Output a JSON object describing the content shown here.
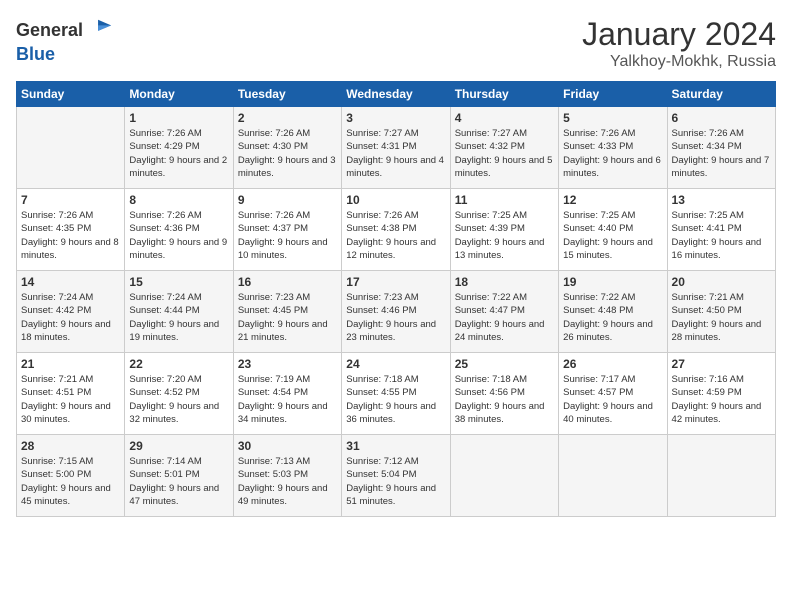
{
  "header": {
    "logo_line1": "General",
    "logo_line2": "Blue",
    "month": "January 2024",
    "location": "Yalkhoy-Mokhk, Russia"
  },
  "days_of_week": [
    "Sunday",
    "Monday",
    "Tuesday",
    "Wednesday",
    "Thursday",
    "Friday",
    "Saturday"
  ],
  "weeks": [
    [
      {
        "day": "",
        "sunrise": "",
        "sunset": "",
        "daylight": ""
      },
      {
        "day": "1",
        "sunrise": "Sunrise: 7:26 AM",
        "sunset": "Sunset: 4:29 PM",
        "daylight": "Daylight: 9 hours and 2 minutes."
      },
      {
        "day": "2",
        "sunrise": "Sunrise: 7:26 AM",
        "sunset": "Sunset: 4:30 PM",
        "daylight": "Daylight: 9 hours and 3 minutes."
      },
      {
        "day": "3",
        "sunrise": "Sunrise: 7:27 AM",
        "sunset": "Sunset: 4:31 PM",
        "daylight": "Daylight: 9 hours and 4 minutes."
      },
      {
        "day": "4",
        "sunrise": "Sunrise: 7:27 AM",
        "sunset": "Sunset: 4:32 PM",
        "daylight": "Daylight: 9 hours and 5 minutes."
      },
      {
        "day": "5",
        "sunrise": "Sunrise: 7:26 AM",
        "sunset": "Sunset: 4:33 PM",
        "daylight": "Daylight: 9 hours and 6 minutes."
      },
      {
        "day": "6",
        "sunrise": "Sunrise: 7:26 AM",
        "sunset": "Sunset: 4:34 PM",
        "daylight": "Daylight: 9 hours and 7 minutes."
      }
    ],
    [
      {
        "day": "7",
        "sunrise": "Sunrise: 7:26 AM",
        "sunset": "Sunset: 4:35 PM",
        "daylight": "Daylight: 9 hours and 8 minutes."
      },
      {
        "day": "8",
        "sunrise": "Sunrise: 7:26 AM",
        "sunset": "Sunset: 4:36 PM",
        "daylight": "Daylight: 9 hours and 9 minutes."
      },
      {
        "day": "9",
        "sunrise": "Sunrise: 7:26 AM",
        "sunset": "Sunset: 4:37 PM",
        "daylight": "Daylight: 9 hours and 10 minutes."
      },
      {
        "day": "10",
        "sunrise": "Sunrise: 7:26 AM",
        "sunset": "Sunset: 4:38 PM",
        "daylight": "Daylight: 9 hours and 12 minutes."
      },
      {
        "day": "11",
        "sunrise": "Sunrise: 7:25 AM",
        "sunset": "Sunset: 4:39 PM",
        "daylight": "Daylight: 9 hours and 13 minutes."
      },
      {
        "day": "12",
        "sunrise": "Sunrise: 7:25 AM",
        "sunset": "Sunset: 4:40 PM",
        "daylight": "Daylight: 9 hours and 15 minutes."
      },
      {
        "day": "13",
        "sunrise": "Sunrise: 7:25 AM",
        "sunset": "Sunset: 4:41 PM",
        "daylight": "Daylight: 9 hours and 16 minutes."
      }
    ],
    [
      {
        "day": "14",
        "sunrise": "Sunrise: 7:24 AM",
        "sunset": "Sunset: 4:42 PM",
        "daylight": "Daylight: 9 hours and 18 minutes."
      },
      {
        "day": "15",
        "sunrise": "Sunrise: 7:24 AM",
        "sunset": "Sunset: 4:44 PM",
        "daylight": "Daylight: 9 hours and 19 minutes."
      },
      {
        "day": "16",
        "sunrise": "Sunrise: 7:23 AM",
        "sunset": "Sunset: 4:45 PM",
        "daylight": "Daylight: 9 hours and 21 minutes."
      },
      {
        "day": "17",
        "sunrise": "Sunrise: 7:23 AM",
        "sunset": "Sunset: 4:46 PM",
        "daylight": "Daylight: 9 hours and 23 minutes."
      },
      {
        "day": "18",
        "sunrise": "Sunrise: 7:22 AM",
        "sunset": "Sunset: 4:47 PM",
        "daylight": "Daylight: 9 hours and 24 minutes."
      },
      {
        "day": "19",
        "sunrise": "Sunrise: 7:22 AM",
        "sunset": "Sunset: 4:48 PM",
        "daylight": "Daylight: 9 hours and 26 minutes."
      },
      {
        "day": "20",
        "sunrise": "Sunrise: 7:21 AM",
        "sunset": "Sunset: 4:50 PM",
        "daylight": "Daylight: 9 hours and 28 minutes."
      }
    ],
    [
      {
        "day": "21",
        "sunrise": "Sunrise: 7:21 AM",
        "sunset": "Sunset: 4:51 PM",
        "daylight": "Daylight: 9 hours and 30 minutes."
      },
      {
        "day": "22",
        "sunrise": "Sunrise: 7:20 AM",
        "sunset": "Sunset: 4:52 PM",
        "daylight": "Daylight: 9 hours and 32 minutes."
      },
      {
        "day": "23",
        "sunrise": "Sunrise: 7:19 AM",
        "sunset": "Sunset: 4:54 PM",
        "daylight": "Daylight: 9 hours and 34 minutes."
      },
      {
        "day": "24",
        "sunrise": "Sunrise: 7:18 AM",
        "sunset": "Sunset: 4:55 PM",
        "daylight": "Daylight: 9 hours and 36 minutes."
      },
      {
        "day": "25",
        "sunrise": "Sunrise: 7:18 AM",
        "sunset": "Sunset: 4:56 PM",
        "daylight": "Daylight: 9 hours and 38 minutes."
      },
      {
        "day": "26",
        "sunrise": "Sunrise: 7:17 AM",
        "sunset": "Sunset: 4:57 PM",
        "daylight": "Daylight: 9 hours and 40 minutes."
      },
      {
        "day": "27",
        "sunrise": "Sunrise: 7:16 AM",
        "sunset": "Sunset: 4:59 PM",
        "daylight": "Daylight: 9 hours and 42 minutes."
      }
    ],
    [
      {
        "day": "28",
        "sunrise": "Sunrise: 7:15 AM",
        "sunset": "Sunset: 5:00 PM",
        "daylight": "Daylight: 9 hours and 45 minutes."
      },
      {
        "day": "29",
        "sunrise": "Sunrise: 7:14 AM",
        "sunset": "Sunset: 5:01 PM",
        "daylight": "Daylight: 9 hours and 47 minutes."
      },
      {
        "day": "30",
        "sunrise": "Sunrise: 7:13 AM",
        "sunset": "Sunset: 5:03 PM",
        "daylight": "Daylight: 9 hours and 49 minutes."
      },
      {
        "day": "31",
        "sunrise": "Sunrise: 7:12 AM",
        "sunset": "Sunset: 5:04 PM",
        "daylight": "Daylight: 9 hours and 51 minutes."
      },
      {
        "day": "",
        "sunrise": "",
        "sunset": "",
        "daylight": ""
      },
      {
        "day": "",
        "sunrise": "",
        "sunset": "",
        "daylight": ""
      },
      {
        "day": "",
        "sunrise": "",
        "sunset": "",
        "daylight": ""
      }
    ]
  ]
}
